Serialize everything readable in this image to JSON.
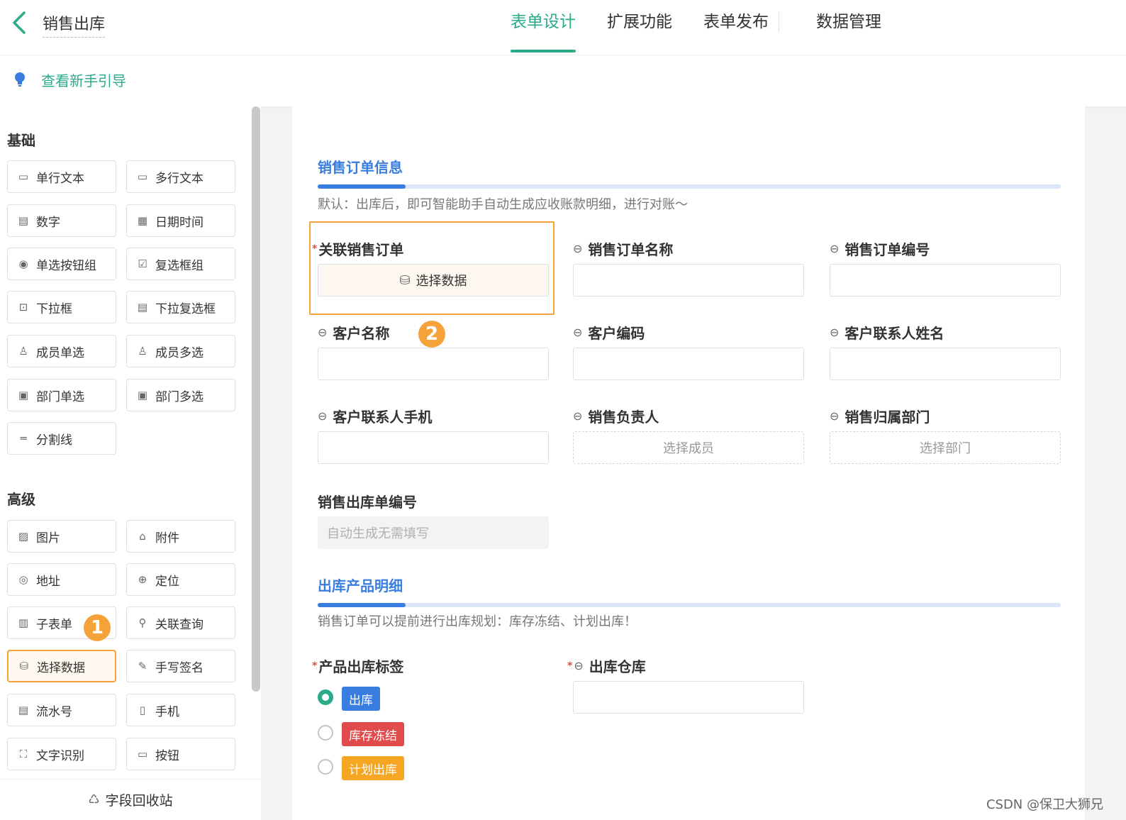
{
  "header": {
    "title": "销售出库",
    "tabs": [
      {
        "label": "表单设计",
        "active": true
      },
      {
        "label": "扩展功能"
      },
      {
        "label": "表单发布"
      },
      {
        "label": "数据管理"
      }
    ]
  },
  "guide": {
    "text": "查看新手引导"
  },
  "sidebar": {
    "basic_title": "基础",
    "basic_fields": [
      {
        "label": "单行文本",
        "icon": "text-input-icon"
      },
      {
        "label": "多行文本",
        "icon": "textarea-icon"
      },
      {
        "label": "数字",
        "icon": "number-icon"
      },
      {
        "label": "日期时间",
        "icon": "calendar-icon"
      },
      {
        "label": "单选按钮组",
        "icon": "radio-icon"
      },
      {
        "label": "复选框组",
        "icon": "checkbox-icon"
      },
      {
        "label": "下拉框",
        "icon": "dropdown-icon"
      },
      {
        "label": "下拉复选框",
        "icon": "multi-dropdown-icon"
      },
      {
        "label": "成员单选",
        "icon": "user-icon"
      },
      {
        "label": "成员多选",
        "icon": "users-icon"
      },
      {
        "label": "部门单选",
        "icon": "dept-icon"
      },
      {
        "label": "部门多选",
        "icon": "depts-icon"
      },
      {
        "label": "分割线",
        "icon": "divider-icon"
      }
    ],
    "advanced_title": "高级",
    "advanced_fields": [
      {
        "label": "图片",
        "icon": "image-icon"
      },
      {
        "label": "附件",
        "icon": "attachment-icon"
      },
      {
        "label": "地址",
        "icon": "location-pin-icon"
      },
      {
        "label": "定位",
        "icon": "crosshair-icon"
      },
      {
        "label": "子表单",
        "icon": "subform-icon"
      },
      {
        "label": "关联查询",
        "icon": "link-search-icon"
      },
      {
        "label": "选择数据",
        "icon": "database-icon",
        "selected": true
      },
      {
        "label": "手写签名",
        "icon": "pen-icon"
      },
      {
        "label": "流水号",
        "icon": "serial-icon"
      },
      {
        "label": "手机",
        "icon": "phone-icon"
      },
      {
        "label": "文字识别",
        "icon": "ocr-icon"
      },
      {
        "label": "按钮",
        "icon": "button-icon"
      }
    ],
    "recycle": "字段回收站",
    "step_badge": "1"
  },
  "form": {
    "section1": {
      "title": "销售订单信息",
      "desc": "默认：出库后，即可智能助手自动生成应收账款明细，进行对账～"
    },
    "linked_order": {
      "label": "关联销售订单",
      "button": "选择数据"
    },
    "order_name": {
      "label": "销售订单名称"
    },
    "order_no": {
      "label": "销售订单编号"
    },
    "customer_name": {
      "label": "客户名称"
    },
    "customer_code": {
      "label": "客户编码"
    },
    "contact_name": {
      "label": "客户联系人姓名"
    },
    "contact_phone": {
      "label": "客户联系人手机"
    },
    "sales_owner": {
      "label": "销售负责人",
      "placeholder": "选择成员"
    },
    "sales_dept": {
      "label": "销售归属部门",
      "placeholder": "选择部门"
    },
    "outbound_no": {
      "label": "销售出库单编号",
      "placeholder": "自动生成无需填写"
    },
    "step_badge": "2",
    "section2": {
      "title": "出库产品明细",
      "desc": "销售订单可以提前进行出库规划：库存冻结、计划出库！"
    },
    "product_tag": {
      "label": "产品出库标签",
      "options": [
        {
          "label": "出库",
          "color": "#3a7de0",
          "checked": true
        },
        {
          "label": "库存冻结",
          "color": "#e24b4b"
        },
        {
          "label": "计划出库",
          "color": "#f5a623"
        }
      ]
    },
    "warehouse": {
      "label": "出库仓库"
    }
  },
  "watermark": "CSDN @保卫大狮兄"
}
